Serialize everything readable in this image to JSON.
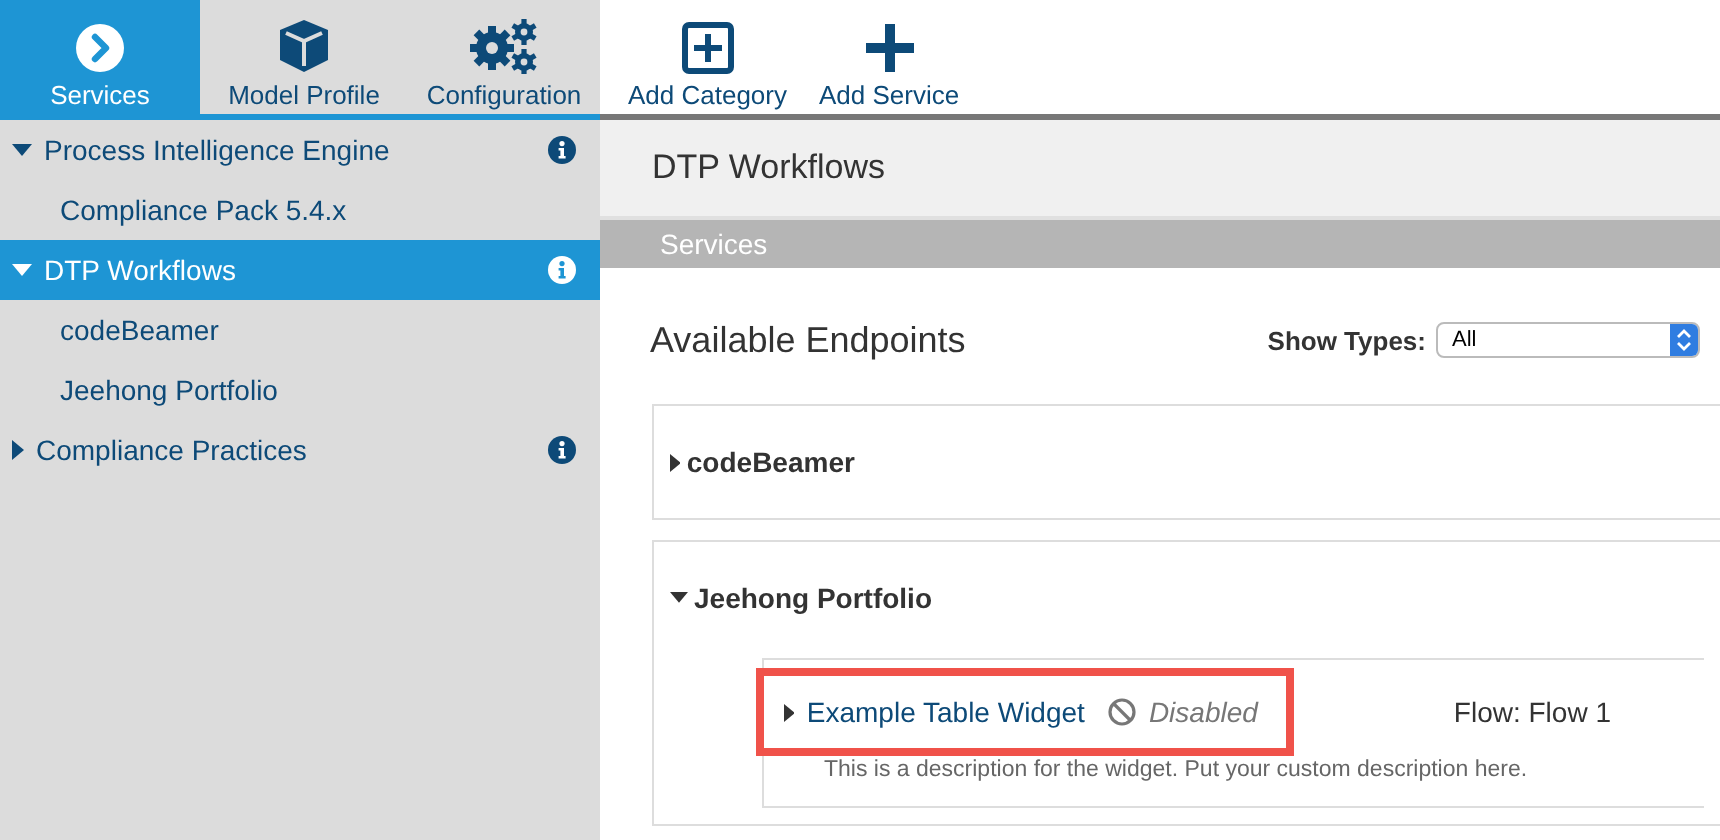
{
  "toolbar": {
    "tabs": [
      {
        "label": "Services",
        "selected": true
      },
      {
        "label": "Model Profile",
        "selected": false
      },
      {
        "label": "Configuration",
        "selected": false
      }
    ],
    "actions": [
      {
        "label": "Add Category"
      },
      {
        "label": "Add Service"
      }
    ]
  },
  "sidebar": {
    "items": [
      {
        "label": "Process Intelligence Engine",
        "expanded": true,
        "selected": false,
        "info": true,
        "children": [
          {
            "label": "Compliance Pack 5.4.x",
            "selected": false
          }
        ]
      },
      {
        "label": "DTP Workflows",
        "expanded": true,
        "selected": true,
        "info": true,
        "children": [
          {
            "label": "codeBeamer",
            "selected": false
          },
          {
            "label": "Jeehong Portfolio",
            "selected": false
          }
        ]
      },
      {
        "label": "Compliance Practices",
        "expanded": false,
        "selected": false,
        "info": true
      }
    ]
  },
  "main": {
    "title": "DTP Workflows",
    "section": "Services",
    "heading": "Available Endpoints",
    "filter": {
      "label": "Show Types:",
      "value": "All"
    },
    "endpoints": [
      {
        "name": "codeBeamer",
        "expanded": false
      },
      {
        "name": "Jeehong Portfolio",
        "expanded": true,
        "widgets": [
          {
            "name": "Example Table Widget",
            "expanded": false,
            "status": "Disabled",
            "flow": "Flow: Flow 1",
            "highlighted": true,
            "description": "This is a description for the widget. Put your custom description here."
          }
        ]
      }
    ]
  }
}
